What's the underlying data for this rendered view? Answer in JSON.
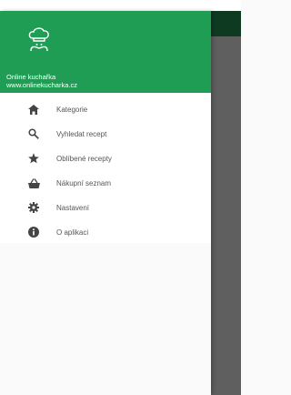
{
  "header": {
    "title": "Online kuchařka",
    "url": "www.onlinekucharka.cz",
    "logo_icon": "chef-hat-icon",
    "color": "#1f9d55"
  },
  "menu": {
    "items": [
      {
        "label": "Kategorie",
        "icon": "home-icon"
      },
      {
        "label": "Vyhledat recept",
        "icon": "search-icon"
      },
      {
        "label": "Oblíbené recepty",
        "icon": "star-icon"
      },
      {
        "label": "Nákupní seznam",
        "icon": "basket-icon"
      },
      {
        "label": "Nastavení",
        "icon": "gear-icon"
      },
      {
        "label": "O aplikaci",
        "icon": "info-icon"
      }
    ]
  }
}
